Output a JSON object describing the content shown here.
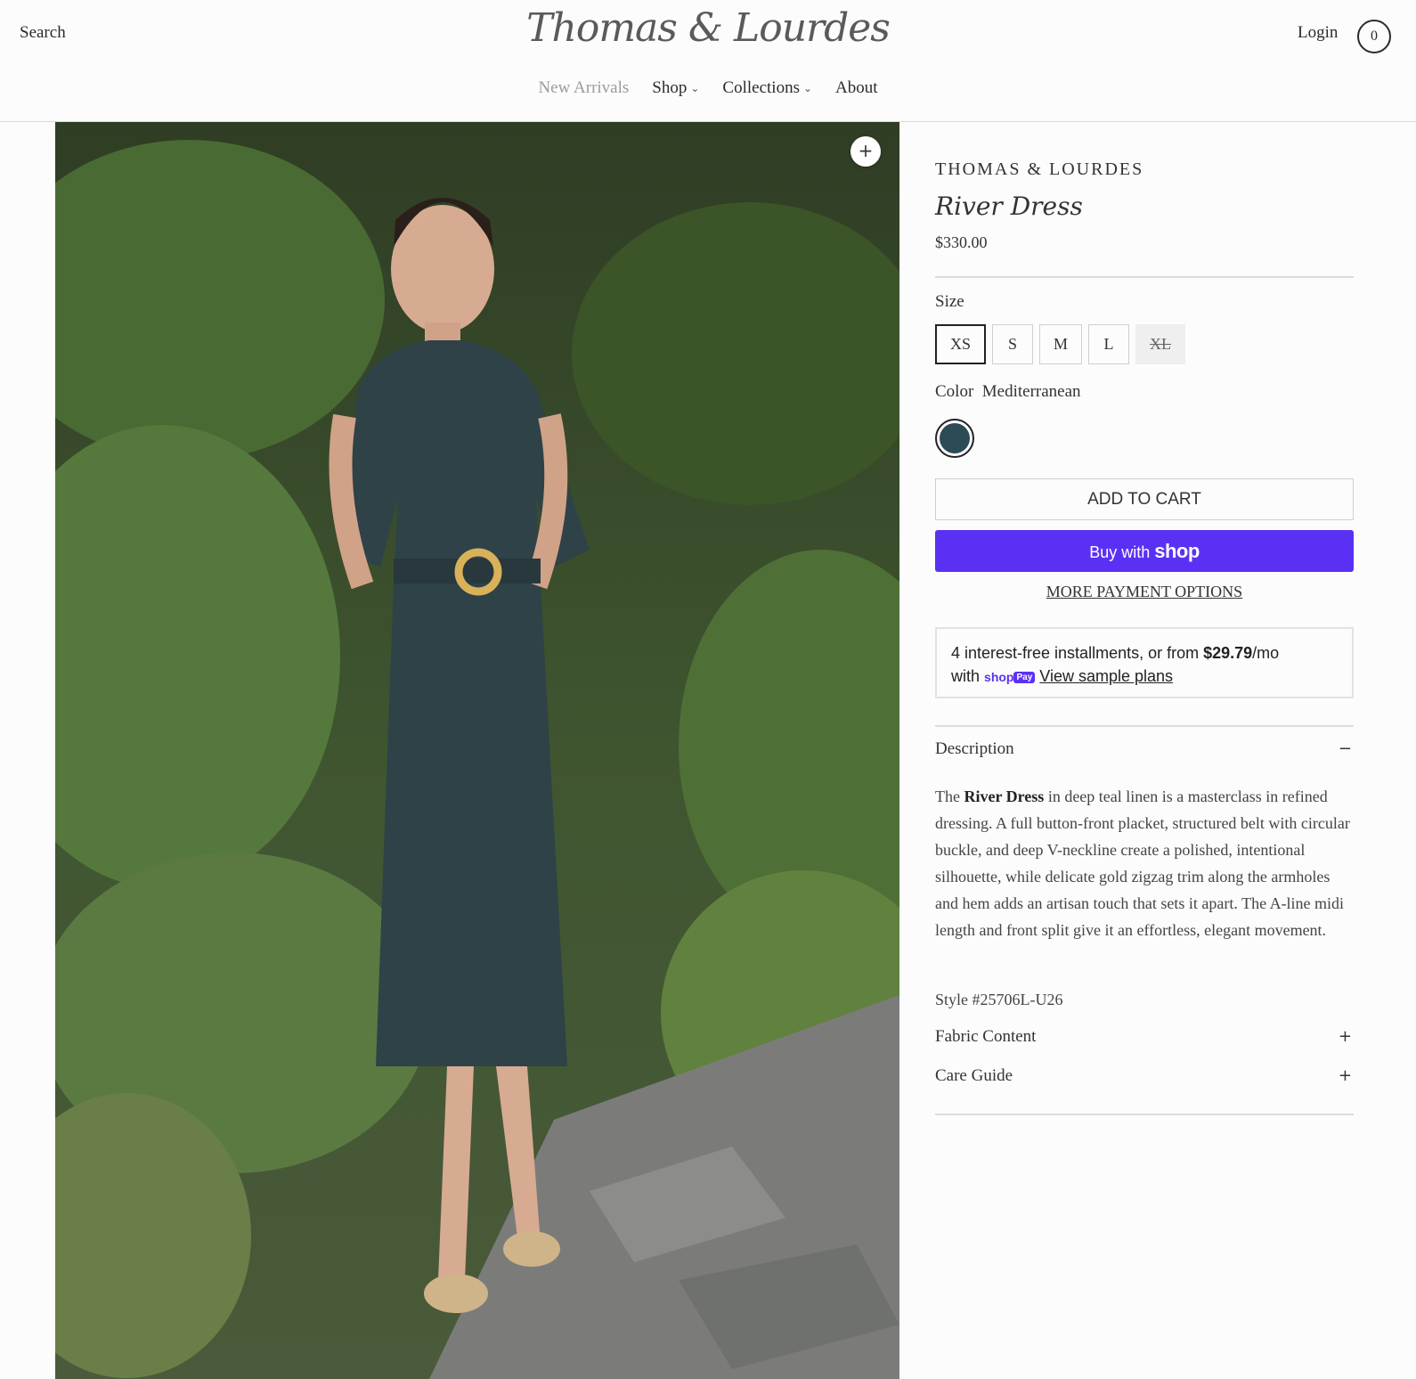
{
  "header": {
    "search_label": "Search",
    "logo_text": "Thomas & Lourdes",
    "login_label": "Login",
    "cart_count": "0"
  },
  "nav": {
    "items": [
      {
        "label": "New Arrivals"
      },
      {
        "label": "Shop"
      },
      {
        "label": "Collections"
      },
      {
        "label": "About"
      }
    ]
  },
  "product": {
    "brand": "THOMAS & LOURDES",
    "title": "River Dress",
    "price": "$330.00",
    "size_label": "Size",
    "sizes": [
      "XS",
      "S",
      "M",
      "L",
      "XL"
    ],
    "selected_size": "XS",
    "sold_out_size": "XL",
    "color_label": "Color",
    "color_value": "Mediterranean",
    "swatch_color": "#2d4b56",
    "add_to_cart": "ADD TO CART",
    "buy_with": "Buy with",
    "shop_mark": "shop",
    "more_payment": "MORE PAYMENT OPTIONS",
    "installments": {
      "text_before": "4 interest-free installments, or from ",
      "amount": "$29.79",
      "per": "/mo",
      "with": "with",
      "badge_shop": "shop",
      "badge_pay": "Pay",
      "view_plans": "View sample plans"
    },
    "description_label": "Description",
    "description": {
      "lead": "The ",
      "name": "River Dress",
      "body": " in deep teal linen is a masterclass in refined dressing. A full button-front placket, structured belt with circular buckle, and deep V-neckline create a polished, intentional silhouette, while delicate gold zigzag trim along the armholes and hem adds an artisan touch that sets it apart. The A-line midi length and front split give it an effortless, elegant movement."
    },
    "style_number": "Style #25706L-U26",
    "fabric_label": "Fabric Content",
    "care_label": "Care Guide"
  },
  "icons": {
    "minus": "−",
    "plus": "+",
    "zoom": "+",
    "chevron": "⌄"
  },
  "colors": {
    "shop_purple": "#5a31f4",
    "dress_teal": "#2d4b56"
  }
}
